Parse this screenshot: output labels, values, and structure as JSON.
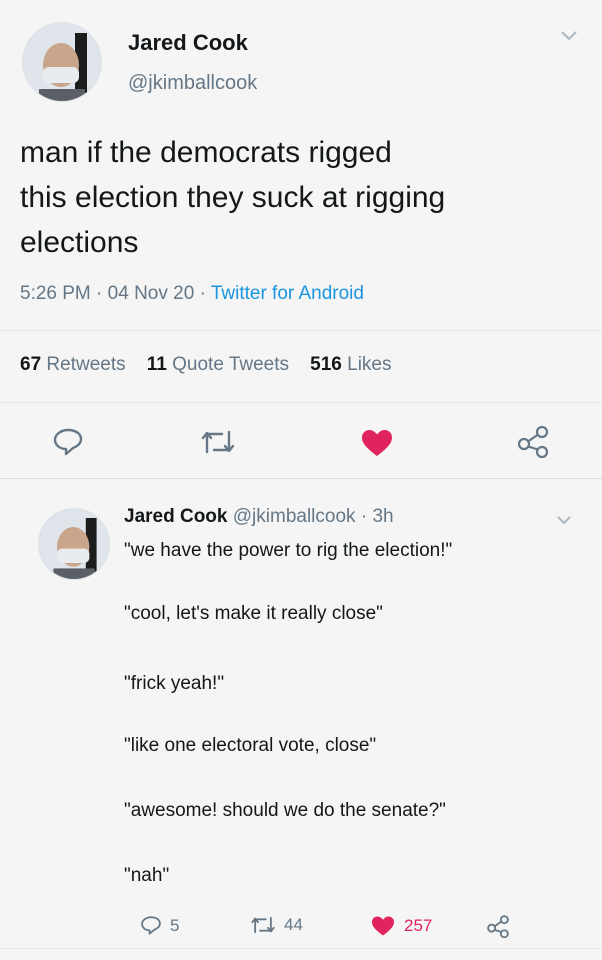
{
  "tweet": {
    "name": "Jared Cook",
    "handle": "@jkimballcook",
    "text_lines": [
      "man if the democrats rigged",
      "this election they suck at rigging",
      "elections"
    ],
    "time": "5:26 PM",
    "date": "04 Nov 20",
    "source": "Twitter for Android",
    "stats": {
      "retweets_count": "67",
      "retweets_label": "Retweets",
      "quotes_count": "11",
      "quotes_label": "Quote Tweets",
      "likes_count": "516",
      "likes_label": "Likes"
    },
    "icons": [
      "reply-icon",
      "retweet-icon",
      "like-icon",
      "share-icon"
    ]
  },
  "reply": {
    "name": "Jared Cook",
    "handle": "@jkimballcook",
    "age": "3h",
    "lines": [
      "\"we have the power to rig the election!\"",
      "\"cool, let's make it really close\"",
      "\"frick yeah!\"",
      "\"like one electoral vote, close\"",
      "\"awesome! should we do the senate?\"",
      "\"nah\""
    ],
    "actions": {
      "replies": "5",
      "retweets": "44",
      "likes": "257"
    }
  },
  "colors": {
    "like": "#e0245e",
    "link": "#1b95e0",
    "muted": "#657786"
  }
}
